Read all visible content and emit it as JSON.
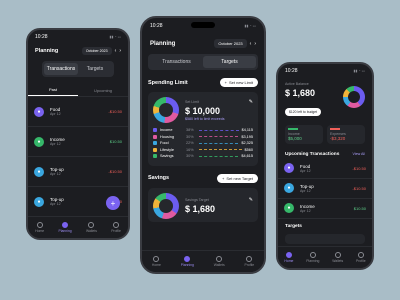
{
  "left": {
    "time": "10:28",
    "title": "Planning",
    "month": "October 2023",
    "tabs": [
      "Transactions",
      "Targets"
    ],
    "subtabs": [
      "Past",
      "Upcoming"
    ],
    "items": [
      {
        "name": "Food",
        "date": "Apr 12",
        "amount": "-$10.50",
        "color": "#7a63f0",
        "icon": "food-icon",
        "positive": false
      },
      {
        "name": "Income",
        "date": "Apr 12",
        "amount": "$10.50",
        "color": "#36b86a",
        "icon": "income-icon",
        "positive": true
      },
      {
        "name": "Top-up",
        "date": "Apr 12",
        "amount": "-$10.50",
        "color": "#3aa7e0",
        "icon": "topup-icon",
        "positive": false
      },
      {
        "name": "Top-up",
        "date": "Apr 12",
        "amount": "-$10.50",
        "color": "#3aa7e0",
        "icon": "topup-icon",
        "positive": false
      }
    ],
    "nav": [
      "Home",
      "Planning",
      "Wallets",
      "Profile"
    ]
  },
  "center": {
    "time": "10:28",
    "title": "Planning",
    "month": "October 2023",
    "tabs": [
      "Transactions",
      "Targets"
    ],
    "spending": {
      "title": "Spending Limit",
      "button": "Set new Limit",
      "label": "Set Limit",
      "amount": "$ 10,000",
      "note": "$580 left to limit exceeds",
      "rows": [
        {
          "name": "Income",
          "pct": "38%",
          "value": "$4,115",
          "color": "#6b5cf0"
        },
        {
          "name": "Housing",
          "pct": "30%",
          "value": "$3,195",
          "color": "#e05aa0"
        },
        {
          "name": "Food",
          "pct": "22%",
          "value": "$2,325",
          "color": "#3aa7e0"
        },
        {
          "name": "Lifestyle",
          "pct": "16%",
          "value": "$560",
          "color": "#f0b43a"
        },
        {
          "name": "Savings",
          "pct": "30%",
          "value": "$4,615",
          "color": "#36b86a"
        }
      ]
    },
    "savings": {
      "title": "Savings",
      "button": "Set new Target",
      "label": "Savings Target",
      "amount": "$ 1,680"
    },
    "nav": [
      "Home",
      "Planning",
      "Wallets",
      "Profile"
    ]
  },
  "right": {
    "time": "10:28",
    "balance_label": "Active Balance",
    "balance": "$ 1,680",
    "budget_button": "$120 left to budget",
    "income_label": "Income",
    "income": "$5,000",
    "expenses_label": "Expenses",
    "expenses": "-$3,320",
    "upcoming_title": "Upcoming Transactions",
    "view_all": "View All",
    "items": [
      {
        "name": "Food",
        "date": "Apr 12",
        "amount": "-$10.50",
        "color": "#7a63f0",
        "icon": "food-icon",
        "positive": false
      },
      {
        "name": "Top-up",
        "date": "Apr 12",
        "amount": "-$10.50",
        "color": "#3aa7e0",
        "icon": "topup-icon",
        "positive": false
      },
      {
        "name": "Income",
        "date": "Apr 12",
        "amount": "$10.50",
        "color": "#36b86a",
        "icon": "income-icon",
        "positive": true
      }
    ],
    "targets_title": "Targets",
    "nav": [
      "Home",
      "Planning",
      "Wallets",
      "Profile"
    ]
  },
  "colors": {
    "accent": "#7a63f0",
    "red": "#f0605a",
    "green": "#5ed18a"
  }
}
